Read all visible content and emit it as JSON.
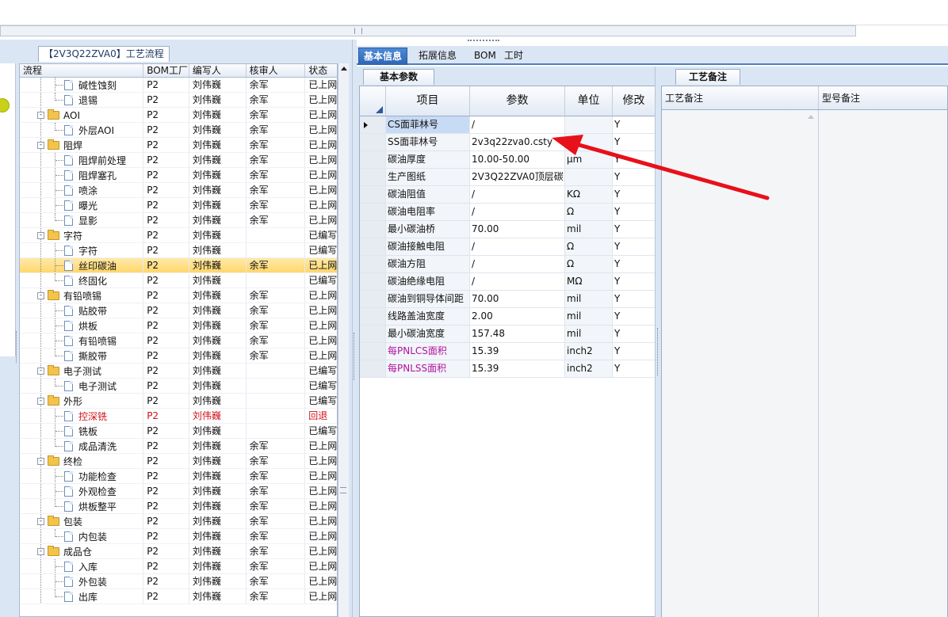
{
  "left_panel": {
    "title": "【2V3Q22ZVA0】工艺流程",
    "columns": [
      "流程",
      "BOM工厂",
      "编写人",
      "核审人",
      "状态"
    ],
    "rows": [
      {
        "level": 2,
        "type": "doc",
        "name": "碱性蚀刻",
        "bom": "P2",
        "writer": "刘伟巍",
        "auditor": "余军",
        "status": "已上网"
      },
      {
        "level": 2,
        "type": "doc",
        "name": "退锡",
        "bom": "P2",
        "writer": "刘伟巍",
        "auditor": "余军",
        "status": "已上网"
      },
      {
        "level": 1,
        "type": "folder",
        "name": "AOI",
        "bom": "P2",
        "writer": "刘伟巍",
        "auditor": "余军",
        "status": "已上网"
      },
      {
        "level": 2,
        "type": "doc",
        "name": "外层AOI",
        "bom": "P2",
        "writer": "刘伟巍",
        "auditor": "余军",
        "status": "已上网"
      },
      {
        "level": 1,
        "type": "folder",
        "name": "阻焊",
        "bom": "P2",
        "writer": "刘伟巍",
        "auditor": "余军",
        "status": "已上网"
      },
      {
        "level": 2,
        "type": "doc",
        "name": "阻焊前处理",
        "bom": "P2",
        "writer": "刘伟巍",
        "auditor": "余军",
        "status": "已上网"
      },
      {
        "level": 2,
        "type": "doc",
        "name": "阻焊塞孔",
        "bom": "P2",
        "writer": "刘伟巍",
        "auditor": "余军",
        "status": "已上网"
      },
      {
        "level": 2,
        "type": "doc",
        "name": "喷涂",
        "bom": "P2",
        "writer": "刘伟巍",
        "auditor": "余军",
        "status": "已上网"
      },
      {
        "level": 2,
        "type": "doc",
        "name": "曝光",
        "bom": "P2",
        "writer": "刘伟巍",
        "auditor": "余军",
        "status": "已上网"
      },
      {
        "level": 2,
        "type": "doc",
        "name": "显影",
        "bom": "P2",
        "writer": "刘伟巍",
        "auditor": "余军",
        "status": "已上网"
      },
      {
        "level": 1,
        "type": "folder",
        "name": "字符",
        "bom": "P2",
        "writer": "刘伟巍",
        "auditor": "",
        "status": "已编写"
      },
      {
        "level": 2,
        "type": "doc",
        "name": "字符",
        "bom": "P2",
        "writer": "刘伟巍",
        "auditor": "",
        "status": "已编写"
      },
      {
        "level": 2,
        "type": "doc",
        "name": "丝印碳油",
        "bom": "P2",
        "writer": "刘伟巍",
        "auditor": "余军",
        "status": "已上网",
        "selected": true
      },
      {
        "level": 2,
        "type": "doc",
        "name": "终固化",
        "bom": "P2",
        "writer": "刘伟巍",
        "auditor": "",
        "status": "已编写"
      },
      {
        "level": 1,
        "type": "folder",
        "name": "有铅喷锡",
        "bom": "P2",
        "writer": "刘伟巍",
        "auditor": "余军",
        "status": "已上网"
      },
      {
        "level": 2,
        "type": "doc",
        "name": "贴胶带",
        "bom": "P2",
        "writer": "刘伟巍",
        "auditor": "余军",
        "status": "已上网"
      },
      {
        "level": 2,
        "type": "doc",
        "name": "烘板",
        "bom": "P2",
        "writer": "刘伟巍",
        "auditor": "余军",
        "status": "已上网"
      },
      {
        "level": 2,
        "type": "doc",
        "name": "有铅喷锡",
        "bom": "P2",
        "writer": "刘伟巍",
        "auditor": "余军",
        "status": "已上网"
      },
      {
        "level": 2,
        "type": "doc",
        "name": "撕胶带",
        "bom": "P2",
        "writer": "刘伟巍",
        "auditor": "余军",
        "status": "已上网"
      },
      {
        "level": 1,
        "type": "folder",
        "name": "电子测试",
        "bom": "P2",
        "writer": "刘伟巍",
        "auditor": "",
        "status": "已编写"
      },
      {
        "level": 2,
        "type": "doc",
        "name": "电子测试",
        "bom": "P2",
        "writer": "刘伟巍",
        "auditor": "",
        "status": "已编写"
      },
      {
        "level": 1,
        "type": "folder",
        "name": "外形",
        "bom": "P2",
        "writer": "刘伟巍",
        "auditor": "",
        "status": "已编写"
      },
      {
        "level": 2,
        "type": "doc",
        "name": "控深铣",
        "bom": "P2",
        "writer": "刘伟巍",
        "auditor": "",
        "status": "回退",
        "red": true
      },
      {
        "level": 2,
        "type": "doc",
        "name": "铣板",
        "bom": "P2",
        "writer": "刘伟巍",
        "auditor": "",
        "status": "已编写"
      },
      {
        "level": 2,
        "type": "doc",
        "name": "成品清洗",
        "bom": "P2",
        "writer": "刘伟巍",
        "auditor": "余军",
        "status": "已上网"
      },
      {
        "level": 1,
        "type": "folder",
        "name": "终检",
        "bom": "P2",
        "writer": "刘伟巍",
        "auditor": "余军",
        "status": "已上网"
      },
      {
        "level": 2,
        "type": "doc",
        "name": "功能检查",
        "bom": "P2",
        "writer": "刘伟巍",
        "auditor": "余军",
        "status": "已上网"
      },
      {
        "level": 2,
        "type": "doc",
        "name": "外观检查",
        "bom": "P2",
        "writer": "刘伟巍",
        "auditor": "余军",
        "status": "已上网"
      },
      {
        "level": 2,
        "type": "doc",
        "name": "烘板整平",
        "bom": "P2",
        "writer": "刘伟巍",
        "auditor": "余军",
        "status": "已上网"
      },
      {
        "level": 1,
        "type": "folder",
        "name": "包装",
        "bom": "P2",
        "writer": "刘伟巍",
        "auditor": "余军",
        "status": "已上网"
      },
      {
        "level": 2,
        "type": "doc",
        "name": "内包装",
        "bom": "P2",
        "writer": "刘伟巍",
        "auditor": "余军",
        "status": "已上网"
      },
      {
        "level": 1,
        "type": "folder",
        "name": "成品仓",
        "bom": "P2",
        "writer": "刘伟巍",
        "auditor": "余军",
        "status": "已上网"
      },
      {
        "level": 2,
        "type": "doc",
        "name": "入库",
        "bom": "P2",
        "writer": "刘伟巍",
        "auditor": "余军",
        "status": "已上网"
      },
      {
        "level": 2,
        "type": "doc",
        "name": "外包装",
        "bom": "P2",
        "writer": "刘伟巍",
        "auditor": "余军",
        "status": "已上网"
      },
      {
        "level": 2,
        "type": "doc",
        "name": "出库",
        "bom": "P2",
        "writer": "刘伟巍",
        "auditor": "余军",
        "status": "已上网"
      }
    ]
  },
  "tabs": [
    "基本信息",
    "拓展信息",
    "BOM",
    "工时"
  ],
  "active_tab": 0,
  "middle_panel": {
    "sub_tab": "基本参数",
    "columns": [
      "项目",
      "参数",
      "单位",
      "修改"
    ],
    "rows": [
      {
        "item": "CS面菲林号",
        "param": "/",
        "unit": "",
        "mod": "Y",
        "selected": true
      },
      {
        "item": "SS面菲林号",
        "param": "2v3q22zva0.csty",
        "unit": "",
        "mod": "Y"
      },
      {
        "item": "碳油厚度",
        "param": "10.00-50.00",
        "unit": "μm",
        "mod": "Y"
      },
      {
        "item": "生产图纸",
        "param": "2V3Q22ZVA0顶层碳...",
        "unit": "",
        "mod": "Y"
      },
      {
        "item": "碳油阻值",
        "param": "/",
        "unit": "KΩ",
        "mod": "Y"
      },
      {
        "item": "碳油电阻率",
        "param": "/",
        "unit": "Ω",
        "mod": "Y"
      },
      {
        "item": "最小碳油桥",
        "param": "70.00",
        "unit": "mil",
        "mod": "Y"
      },
      {
        "item": "碳油接触电阻",
        "param": "/",
        "unit": "Ω",
        "mod": "Y"
      },
      {
        "item": "碳油方阻",
        "param": "/",
        "unit": "Ω",
        "mod": "Y"
      },
      {
        "item": "碳油绝缘电阻",
        "param": "/",
        "unit": "MΩ",
        "mod": "Y"
      },
      {
        "item": "碳油到铜导体间距",
        "param": "70.00",
        "unit": "mil",
        "mod": "Y"
      },
      {
        "item": "线路盖油宽度",
        "param": "2.00",
        "unit": "mil",
        "mod": "Y"
      },
      {
        "item": "最小碳油宽度",
        "param": "157.48",
        "unit": "mil",
        "mod": "Y"
      },
      {
        "item": "每PNLCS面积",
        "param": "15.39",
        "unit": "inch2",
        "mod": "Y",
        "magenta": true
      },
      {
        "item": "每PNLSS面积",
        "param": "15.39",
        "unit": "inch2",
        "mod": "Y",
        "magenta": true
      }
    ]
  },
  "right_panel": {
    "sub_tab": "工艺备注",
    "columns": [
      "工艺备注",
      "型号备注"
    ]
  },
  "colors": {
    "accent": "#2c65b4",
    "selected_row": "#ffd76b",
    "error_text": "#d0121b",
    "magenta_text": "#b1139f",
    "annotation_arrow": "#e8101a"
  }
}
